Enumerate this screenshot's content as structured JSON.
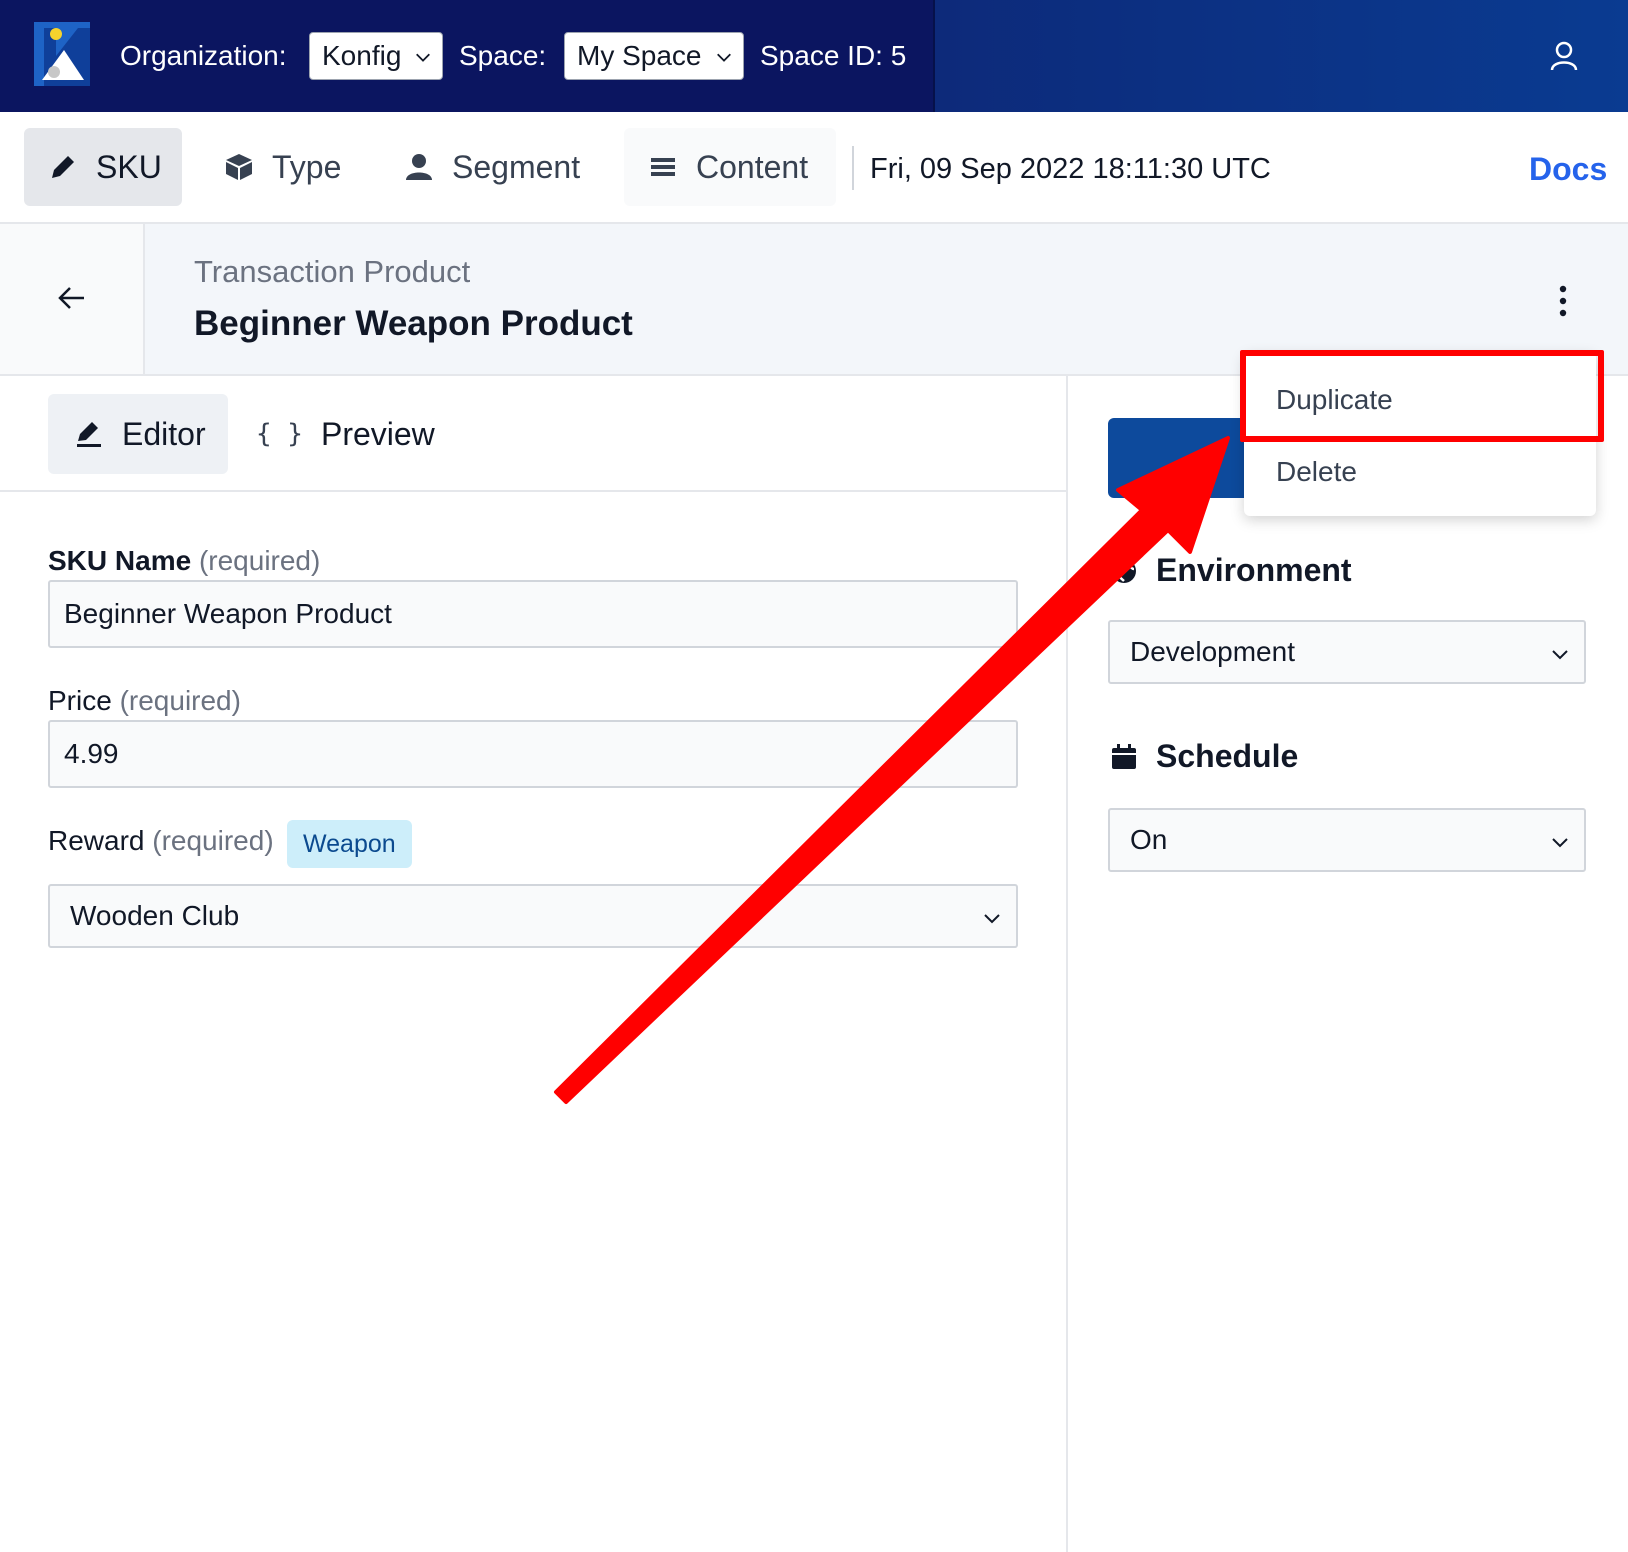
{
  "topbar": {
    "org_label": "Organization:",
    "org_value": "Konfig",
    "space_label": "Space:",
    "space_value": "My Space",
    "space_id": "Space ID: 5"
  },
  "nav": {
    "tabs": [
      {
        "label": "SKU",
        "icon": "pencil-icon"
      },
      {
        "label": "Type",
        "icon": "cube-icon"
      },
      {
        "label": "Segment",
        "icon": "user-icon"
      },
      {
        "label": "Content",
        "icon": "list-icon"
      }
    ],
    "timestamp": "Fri, 09 Sep 2022 18:11:30 UTC",
    "docs": "Docs"
  },
  "header": {
    "subtitle": "Transaction Product",
    "title": "Beginner Weapon Product"
  },
  "subtabs": {
    "editor": "Editor",
    "preview": "Preview",
    "preview_icon_text": "{ }"
  },
  "form": {
    "sku_name_label": "SKU Name",
    "sku_name_req": "(required)",
    "sku_name_value": "Beginner Weapon Product",
    "price_label": "Price",
    "price_req": "(required)",
    "price_value": "4.99",
    "reward_label": "Reward",
    "reward_req": "(required)",
    "reward_tag": "Weapon",
    "reward_value": "Wooden Club"
  },
  "sidebar": {
    "environment_label": "Environment",
    "environment_value": "Development",
    "schedule_label": "Schedule",
    "schedule_value": "On"
  },
  "menu": {
    "items": [
      "Duplicate",
      "Delete"
    ]
  },
  "colors": {
    "topbar": "#0b1560",
    "accent": "#2563eb",
    "annotation": "#ff0000",
    "tag_bg": "#cdeefa"
  }
}
